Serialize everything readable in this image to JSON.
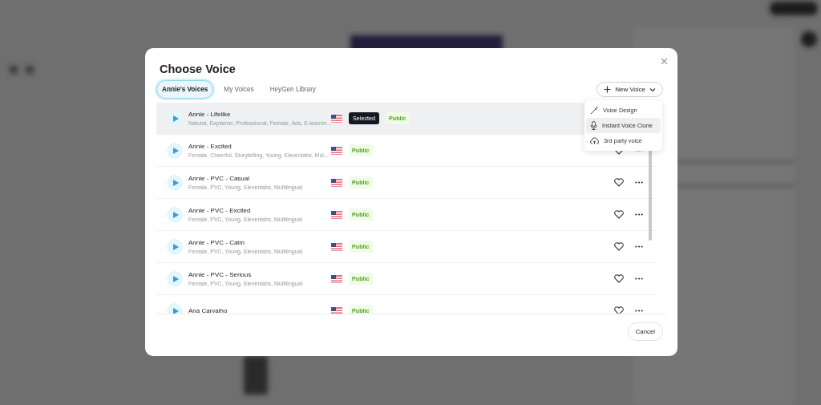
{
  "dialog": {
    "title": "Choose Voice",
    "tabs": [
      {
        "label": "Annie's Voices",
        "selected": true
      },
      {
        "label": "My Voices",
        "selected": false
      },
      {
        "label": "HeyGen Library",
        "selected": false
      }
    ],
    "new_voice_button": {
      "label": "New Voice",
      "expanded": true
    },
    "new_voice_menu": [
      {
        "label": "Voice Design",
        "kind": "design",
        "selected": false
      },
      {
        "label": "Instant Voice Clone",
        "kind": "clone",
        "selected": true
      },
      {
        "label": "3rd party voice",
        "kind": "upload",
        "selected": false
      }
    ],
    "voices": [
      {
        "name": "Annie - Lifelike",
        "tags": "Natural, Explainer, Professional, Female, Ads, E-learnin...",
        "selected": true,
        "badge": "Selected",
        "visibility": "Public"
      },
      {
        "name": "Annie - Excited",
        "tags": "Female, Cheerful, Storytelling, Young, Elevenlabs, Mul...",
        "selected": false,
        "visibility": "Public"
      },
      {
        "name": "Annie - PVC - Casual",
        "tags": "Female, PVC, Young, Elevenlabs, Multilingual",
        "selected": false,
        "visibility": "Public"
      },
      {
        "name": "Annie - PVC - Excited",
        "tags": "Female, PVC, Young, Elevenlabs, Multilingual",
        "selected": false,
        "visibility": "Public"
      },
      {
        "name": "Annie - PVC - Calm",
        "tags": "Female, PVC, Young, Elevenlabs, Multilingual",
        "selected": false,
        "visibility": "Public"
      },
      {
        "name": "Annie - PVC - Serious",
        "tags": "Female, PVC, Young, Elevenlabs, Multilingual",
        "selected": false,
        "visibility": "Public"
      },
      {
        "name": "Ana Carvalho",
        "selected": false,
        "visibility": "Public"
      }
    ],
    "cancel_button": "Cancel"
  }
}
